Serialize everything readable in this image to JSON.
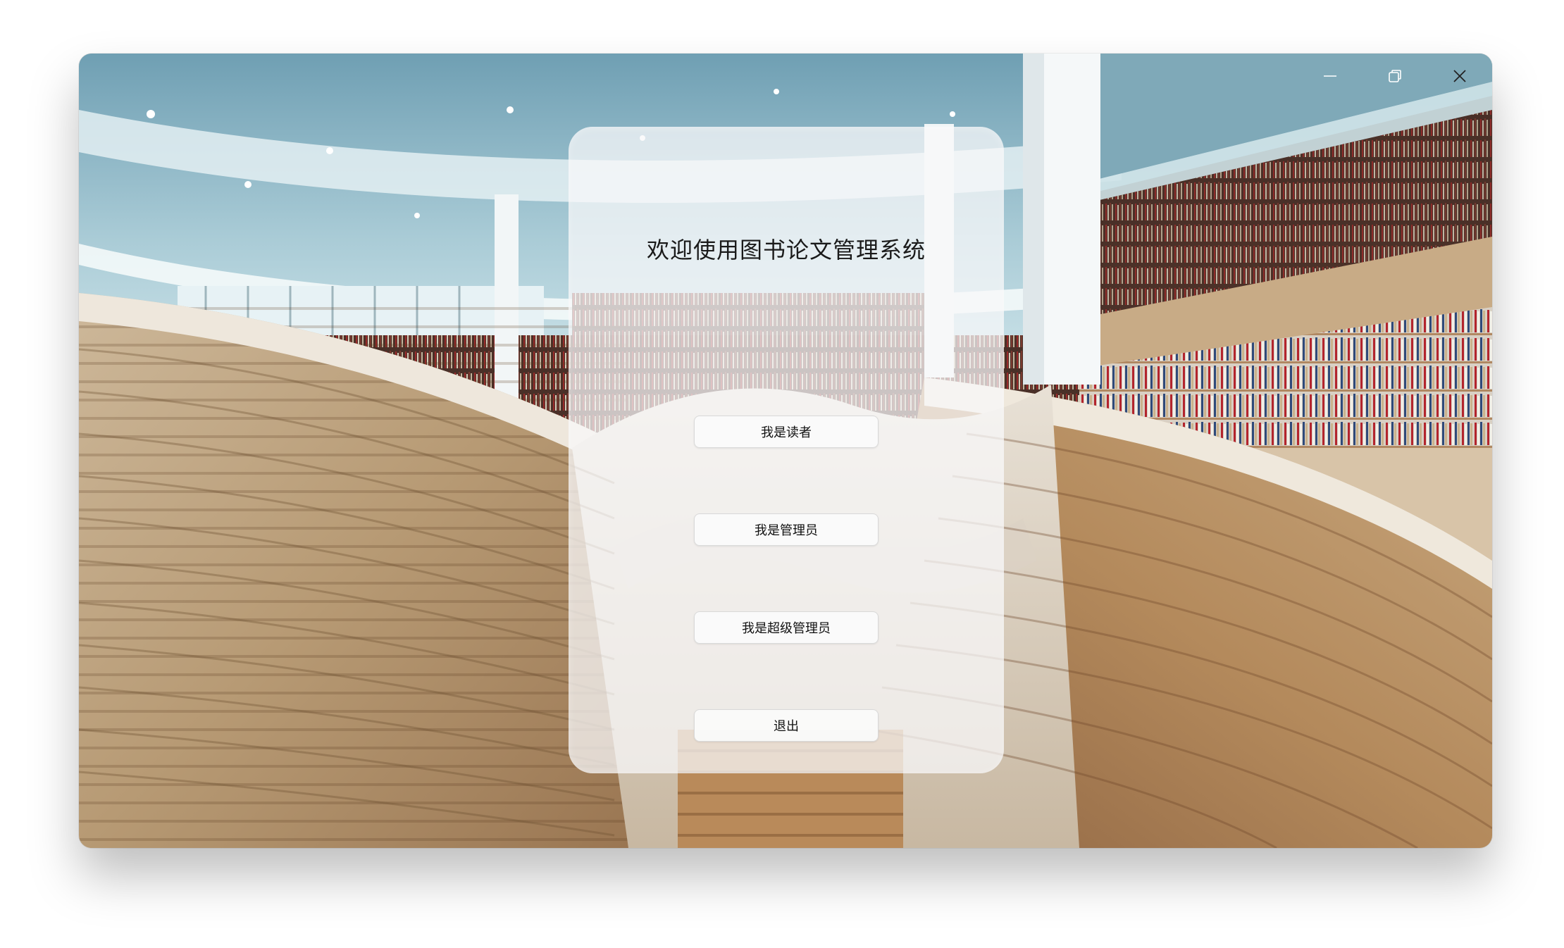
{
  "panel": {
    "title": "欢迎使用图书论文管理系统"
  },
  "buttons": {
    "reader": "我是读者",
    "admin": "我是管理员",
    "super_admin": "我是超级管理员",
    "exit": "退出"
  },
  "window_controls": {
    "minimize_icon": "minimize-icon",
    "restore_icon": "restore-icon",
    "close_icon": "close-icon"
  },
  "colors": {
    "panel_bg": "#f8f8fa",
    "button_bg": "#fafafa",
    "button_border": "#d9d9d9",
    "title_text": "#1a1a1a"
  }
}
